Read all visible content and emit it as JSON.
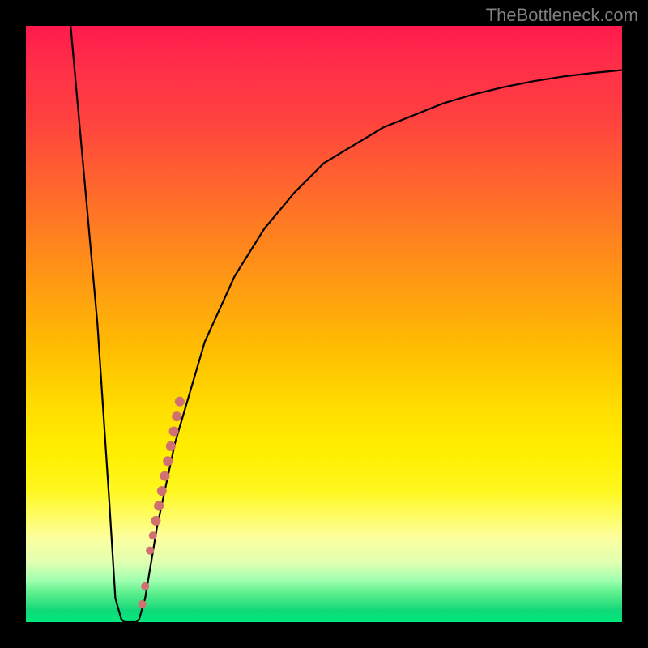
{
  "watermark": "TheBottleneck.com",
  "chart_data": {
    "type": "line",
    "title": "",
    "xlabel": "",
    "ylabel": "",
    "xlim": [
      0,
      100
    ],
    "ylim": [
      0,
      100
    ],
    "grid": false,
    "series": [
      {
        "name": "curve",
        "points": [
          [
            7.5,
            100
          ],
          [
            12.0,
            50
          ],
          [
            14.0,
            20
          ],
          [
            15.0,
            4
          ],
          [
            16.0,
            0.5
          ],
          [
            16.5,
            0
          ],
          [
            18.5,
            0
          ],
          [
            19.0,
            0.5
          ],
          [
            20.0,
            4
          ],
          [
            22.0,
            16
          ],
          [
            25.0,
            30
          ],
          [
            30.0,
            47
          ],
          [
            35.0,
            58
          ],
          [
            40.0,
            66
          ],
          [
            45.0,
            72
          ],
          [
            50.0,
            77
          ],
          [
            55.0,
            80
          ],
          [
            60.0,
            83
          ],
          [
            65.0,
            85
          ],
          [
            70.0,
            87
          ],
          [
            75.0,
            88.5
          ],
          [
            80.0,
            89.7
          ],
          [
            85.0,
            90.7
          ],
          [
            90.0,
            91.5
          ],
          [
            95.0,
            92.1
          ],
          [
            100.0,
            92.6
          ]
        ]
      }
    ],
    "dots": {
      "name": "data-points",
      "color": "#d17070",
      "points": [
        [
          19.5,
          3.0,
          5
        ],
        [
          20.0,
          6.0,
          5
        ],
        [
          20.8,
          12.0,
          5
        ],
        [
          21.3,
          14.5,
          5
        ],
        [
          21.8,
          17.0,
          6
        ],
        [
          22.3,
          19.5,
          6
        ],
        [
          22.8,
          22.0,
          6
        ],
        [
          23.3,
          24.5,
          6
        ],
        [
          23.8,
          27.0,
          6
        ],
        [
          24.3,
          29.5,
          6
        ],
        [
          24.8,
          32.0,
          6
        ],
        [
          25.3,
          34.5,
          6
        ],
        [
          25.8,
          37.0,
          6
        ]
      ]
    }
  },
  "gradient_colors": {
    "top": "#ff1a4d",
    "mid_upper": "#ff8020",
    "mid": "#ffe000",
    "mid_lower": "#fcffa0",
    "bottom": "#00e87c"
  }
}
